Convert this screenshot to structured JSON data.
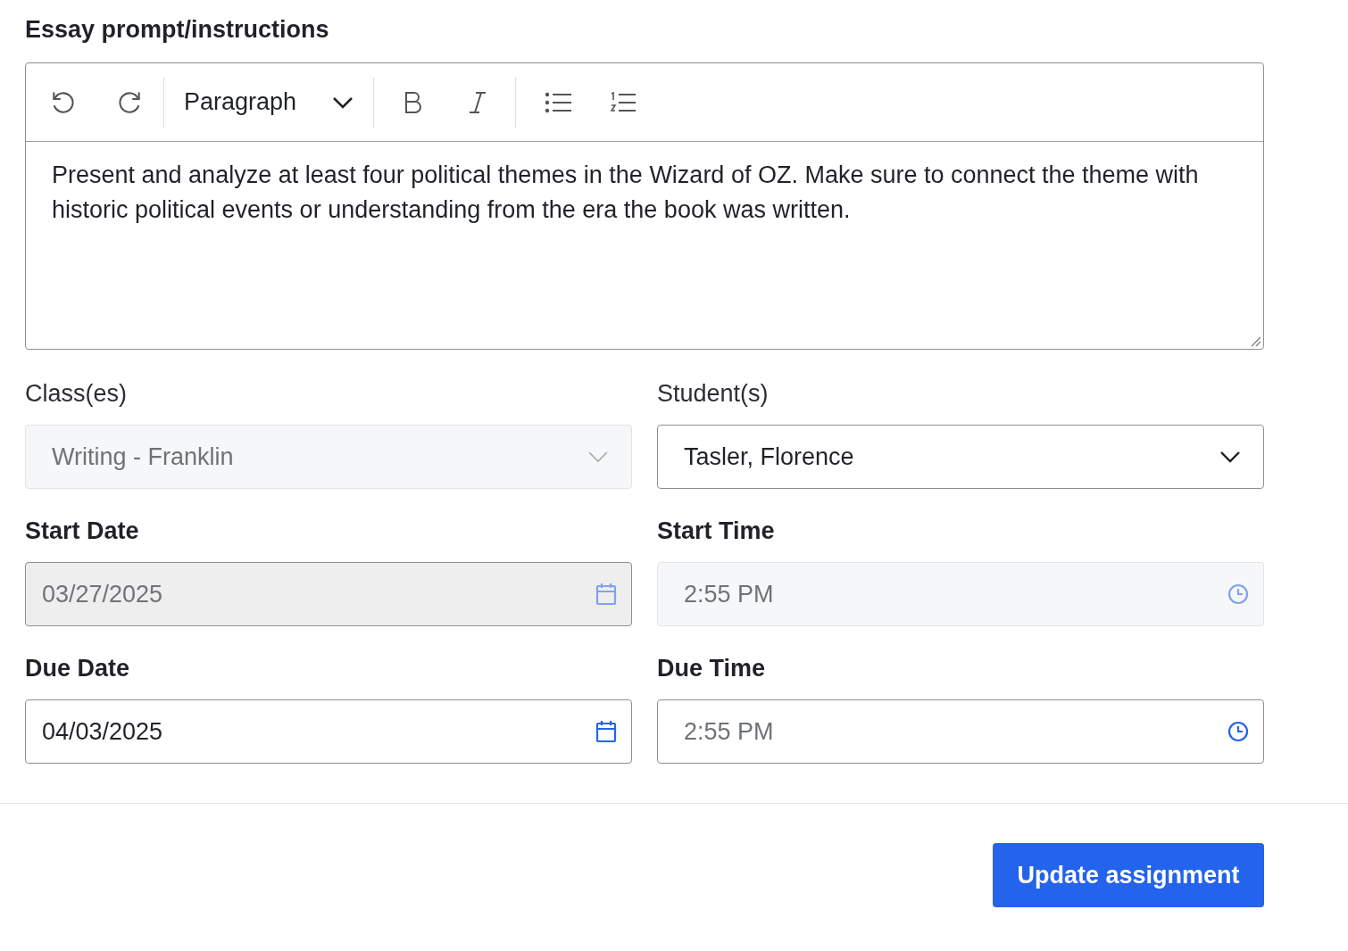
{
  "prompt": {
    "label": "Essay prompt/instructions",
    "toolbar": {
      "block_style": "Paragraph"
    },
    "text": "Present and analyze at least four political themes in the Wizard of OZ. Make sure to connect the theme with historic political events or understanding from the era the book was written."
  },
  "fields": [
    {
      "label": "Class(es)",
      "label_bold": false,
      "kind": "select",
      "value": "Writing - Franklin",
      "disabled": true
    },
    {
      "label": "Student(s)",
      "label_bold": false,
      "kind": "select",
      "value": "Tasler, Florence",
      "disabled": false
    },
    {
      "label": "Start Date",
      "label_bold": true,
      "kind": "date",
      "value": "03/27/2025",
      "disabled": true
    },
    {
      "label": "Start Time",
      "label_bold": true,
      "kind": "time",
      "value": "2:55 PM",
      "disabled": true
    },
    {
      "label": "Due Date",
      "label_bold": true,
      "kind": "date",
      "value": "04/03/2025",
      "disabled": false
    },
    {
      "label": "Due Time",
      "label_bold": true,
      "kind": "time",
      "value": "2:55 PM",
      "disabled": false
    }
  ],
  "submit": "Update assignment"
}
